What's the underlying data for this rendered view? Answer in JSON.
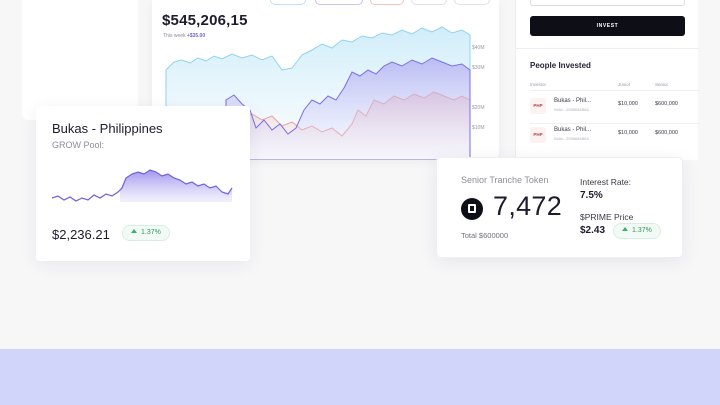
{
  "dashboard": {
    "total_value": "$545,206,15",
    "week_label": "This week",
    "week_change": "+$35.00",
    "y_axis": [
      "$40M",
      "$30M",
      "$20M",
      "$10M"
    ]
  },
  "sidebar": {
    "invest_label": "INVEST",
    "people_title": "People Invested",
    "columns": [
      "Investor",
      "Junior",
      "Senior"
    ],
    "rows": [
      {
        "logo": "PHP",
        "name": "Bukas - Phil...",
        "id": "0x6b...2056684B84",
        "junior": "$10,000",
        "senior": "$600,000"
      },
      {
        "logo": "PHP",
        "name": "Bukas - Phil...",
        "id": "0x6b...2056684B84",
        "junior": "$10,000",
        "senior": "$600,000"
      }
    ]
  },
  "pool_card": {
    "title": "Bukas - Philippines",
    "subtitle": "GROW Pool:",
    "price": "$2,236.21",
    "change": "1.37%"
  },
  "tranche_card": {
    "label": "Senior Tranche Token",
    "amount": "7,472",
    "total": "Total $600000",
    "rate_label": "Interest Rate:",
    "rate": "7.5%",
    "price_label": "$PRIME Price",
    "price": "$2.43",
    "price_change": "1.37%"
  },
  "colors": {
    "accent_purple": "#7b6fe0",
    "accent_blue": "#8fd3f0",
    "accent_red": "#f0a39c",
    "positive_green": "#2f9a5c",
    "band": "#d1d5fa"
  }
}
